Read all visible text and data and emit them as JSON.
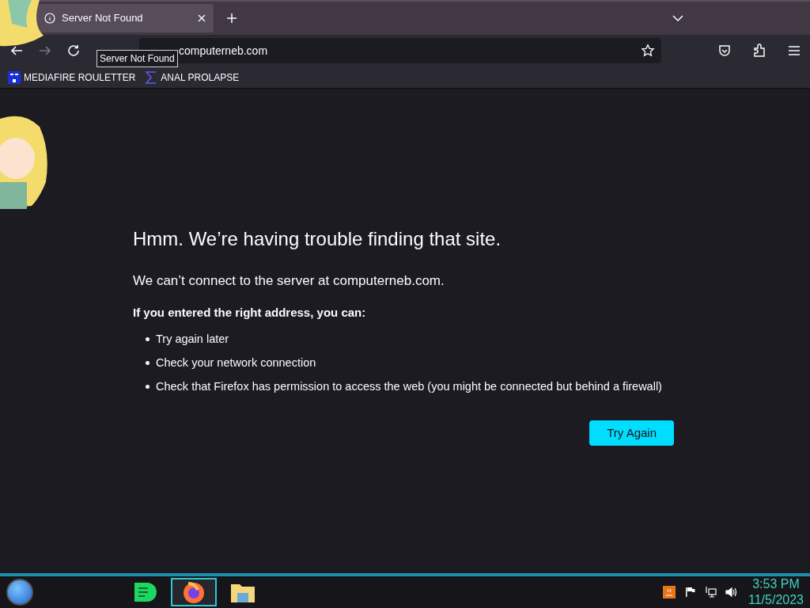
{
  "tabs": [
    {
      "title": "Server Not Found",
      "selected": true
    }
  ],
  "tooltip": "Server Not Found",
  "address_bar": {
    "value": "computerneb.com"
  },
  "bookmarks": [
    {
      "label": "MEDIAFIRE ROULETTER",
      "kind": "mf"
    },
    {
      "label": "ANAL PROLAPSE",
      "kind": "sigma"
    }
  ],
  "error_page": {
    "title": "Hmm. We’re having trouble finding that site.",
    "message": "We can’t connect to the server at computerneb.com.",
    "heading": "If you entered the right address, you can:",
    "suggestions": [
      "Try again later",
      "Check your network connection",
      "Check that Firefox has permission to access the web (you might be connected but behind a firewall)"
    ],
    "button": "Try Again"
  },
  "taskbar": {
    "apps": [
      {
        "kind": "music",
        "selected": false
      },
      {
        "kind": "browser",
        "selected": true
      },
      {
        "kind": "folder",
        "selected": false
      }
    ],
    "time": "3:53 PM",
    "date": "11/5/2023"
  }
}
